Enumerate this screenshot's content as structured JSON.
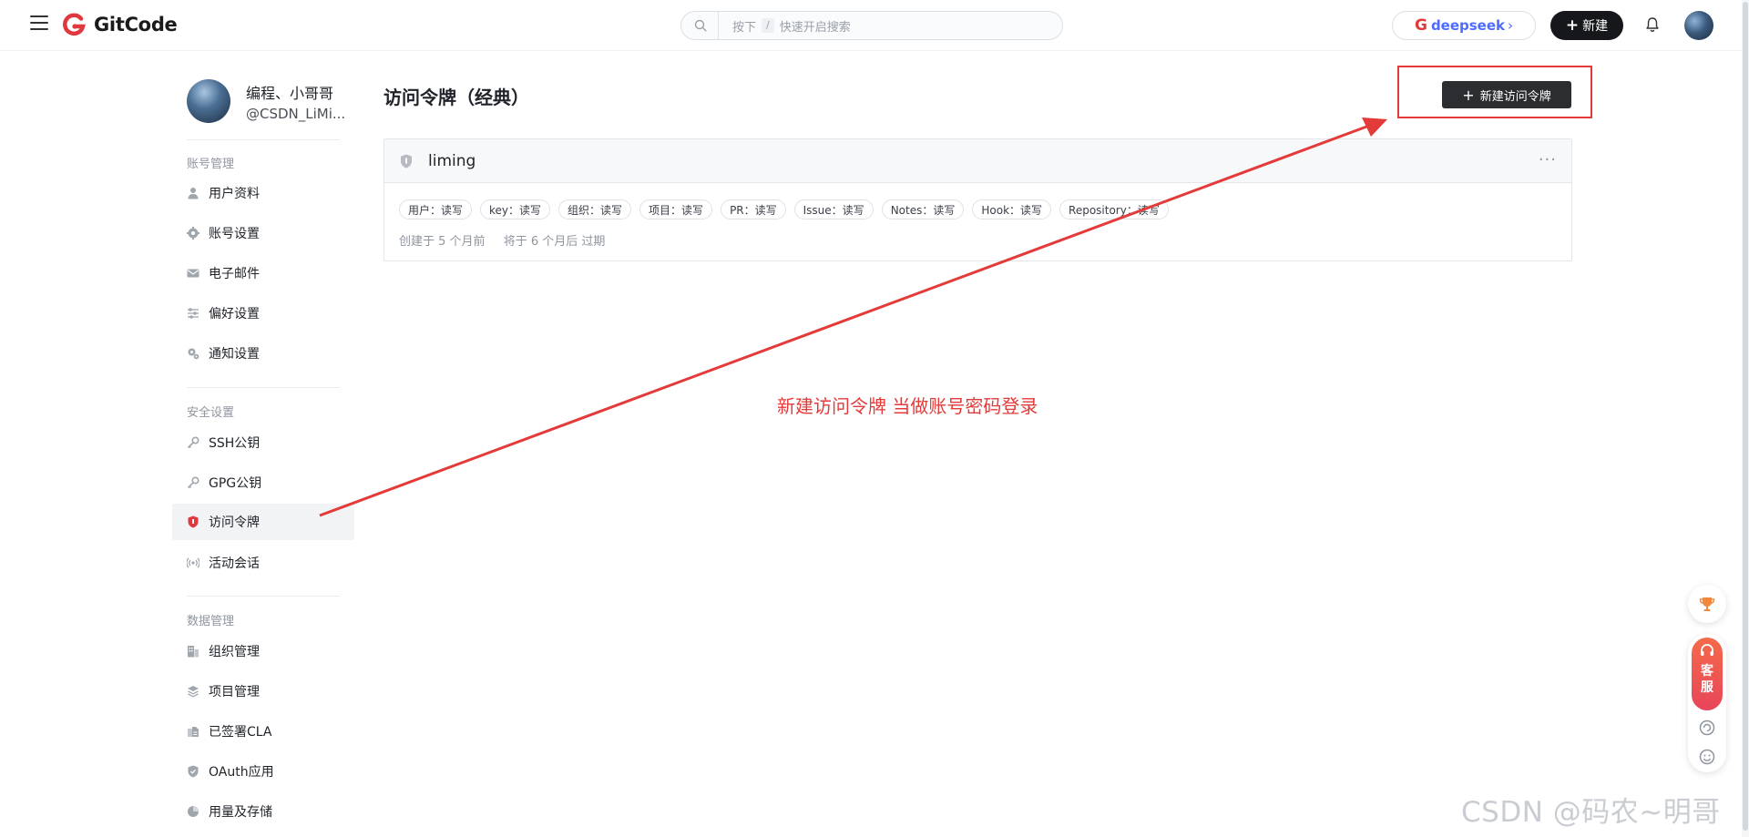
{
  "header": {
    "logo_text": "GitCode",
    "search": {
      "prefix": "按下",
      "key": "/",
      "suffix": "快速开启搜索"
    },
    "deepseek_label": "deepseek",
    "deepseek_mark": "G",
    "deepseek_chevron": "›",
    "new_label": "新建",
    "plus": "+"
  },
  "profile": {
    "name": "编程、小哥哥",
    "handle": "@CSDN_LiMi..."
  },
  "sidebar": {
    "sections": [
      {
        "title": "账号管理"
      },
      {
        "title": "安全设置"
      },
      {
        "title": "数据管理"
      }
    ],
    "items": [
      {
        "label": "用户资料",
        "icon": "user-icon"
      },
      {
        "label": "账号设置",
        "icon": "gear-icon"
      },
      {
        "label": "电子邮件",
        "icon": "mail-icon"
      },
      {
        "label": "偏好设置",
        "icon": "sliders-icon"
      },
      {
        "label": "通知设置",
        "icon": "notification-gear-icon"
      },
      {
        "label": "SSH公钥",
        "icon": "key-icon"
      },
      {
        "label": "GPG公钥",
        "icon": "key-icon"
      },
      {
        "label": "访问令牌",
        "icon": "shield-icon",
        "active": true
      },
      {
        "label": "活动会话",
        "icon": "broadcast-icon"
      },
      {
        "label": "组织管理",
        "icon": "building-icon"
      },
      {
        "label": "项目管理",
        "icon": "layers-icon"
      },
      {
        "label": "已签署CLA",
        "icon": "document-sign-icon"
      },
      {
        "label": "OAuth应用",
        "icon": "shield-check-icon"
      },
      {
        "label": "用量及存储",
        "icon": "pie-chart-icon"
      }
    ]
  },
  "main": {
    "title": "访问令牌（经典）",
    "create_button": "新建访问令牌",
    "token": {
      "name": "liming",
      "more": "···",
      "scopes": [
        "用户：读写",
        "key：读写",
        "组织：读写",
        "项目：读写",
        "PR：读写",
        "Issue：读写",
        "Notes：读写",
        "Hook：读写",
        "Repository：读写"
      ],
      "created": "创建于 5 个月前",
      "expires": "将于 6 个月后 过期"
    },
    "annotation": "新建访问令牌 当做账号密码登录"
  },
  "float": {
    "kefu_chars": [
      "客",
      "服"
    ]
  },
  "watermark": "CSDN @码农~明哥",
  "colors": {
    "accent_red": "#e33a3a",
    "brand_red": "#e0383e",
    "dark_button": "#2b2d31",
    "deepseek_blue": "#4d6bfe"
  }
}
